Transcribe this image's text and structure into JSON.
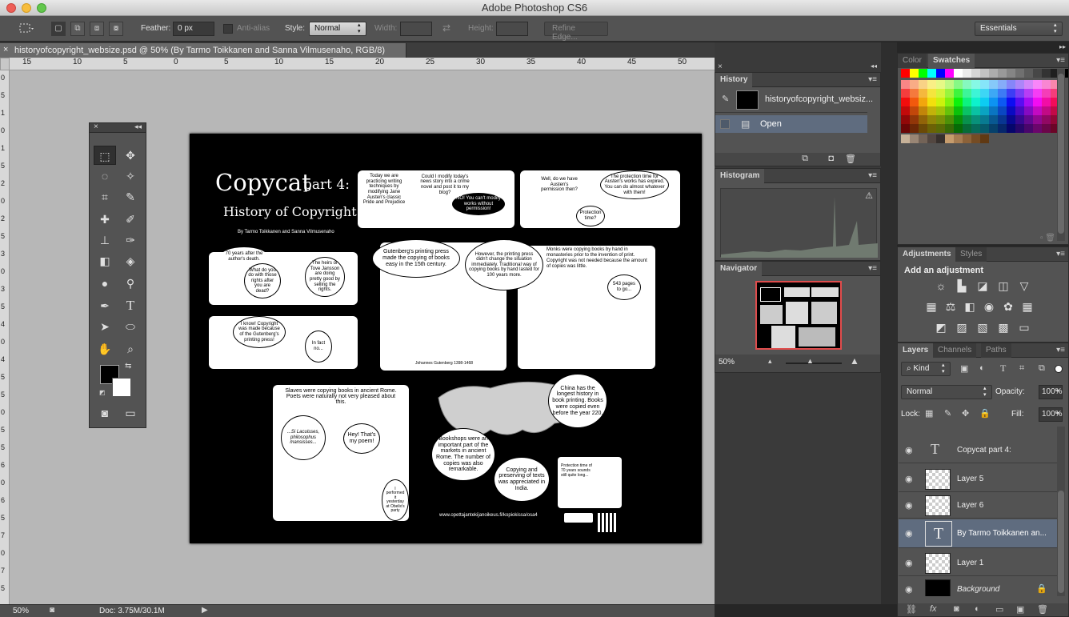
{
  "app": {
    "title": "Adobe Photoshop CS6"
  },
  "options": {
    "feather_label": "Feather:",
    "feather_value": "0 px",
    "antialias_label": "Anti-alias",
    "style_label": "Style:",
    "style_value": "Normal",
    "width_label": "Width:",
    "height_label": "Height:",
    "refine_edge": "Refine Edge...",
    "workspace": "Essentials"
  },
  "document": {
    "tab_title": "historyofcopyright_websize.psd @ 50% (By Tarmo Toikkanen and Sanna Vilmusenaho, RGB/8)",
    "zoom": "50%",
    "doc_size": "Doc: 3.75M/30.1M"
  },
  "ruler": {
    "h_ticks": [
      "15",
      "10",
      "5",
      "0",
      "5",
      "10",
      "15",
      "20",
      "25",
      "30",
      "35",
      "40",
      "45",
      "50"
    ],
    "v_ticks": [
      "0",
      "5",
      "1",
      "0",
      "1",
      "5",
      "2",
      "0",
      "2",
      "5",
      "3",
      "0",
      "3",
      "5",
      "4",
      "0",
      "4",
      "5",
      "5",
      "0",
      "5",
      "5",
      "6",
      "0",
      "6",
      "5",
      "7",
      "0",
      "7",
      "5"
    ]
  },
  "artwork": {
    "title": "Copycat",
    "part": "part 4:",
    "subtitle": "History of Copyright",
    "byline": "By Tarmo Toikkanen and Sanna Vilmusenaho",
    "url": "www.opettajantekijanoikeus.fi/kopiokissa/osa4",
    "bubbles": {
      "b1": "Today we are practicing writing techniques by modifying Jane Austen's classic Pride and Prejudice",
      "b2": "Could I modify today's news story into a crime novel and post it to my blog?",
      "b3": "NO! You can't modify works without permission!",
      "b4": "Well, do we have Austen's permission then?",
      "b5": "The protection time for Austen's works has expired. You can do almost whatever with them!",
      "b6": "Protection time?",
      "b7": "70 years after the author's death.",
      "b8": "What do you do with those rights after you are dead?",
      "b9": "The heirs or Tove Jansson are doing pretty good by selling the rights.",
      "b10": "Gutenberg's printing press made the copying of books easy in the 15th century.",
      "b11": "However, the printing press didn't change the situation immediately. Traditional way of copying books by hand lasted for 100 years more.",
      "b12": "Monks were copying books by hand in monasteries prior to the invention of print. Copyright was not needed because the amount of copies was little.",
      "b13": "543 pages to go...",
      "b14": "I know! Copyright was made because of the Gutenberg's printing press!",
      "b15": "In fact no...",
      "caption_gutenberg": "Johannes Gutenberg 1398-1468",
      "b16": "Slaves were copying books in ancient Rome. Poets were naturally not very pleased about this.",
      "b17": "...Si Lacuisses, philosophus mansisses...",
      "b18": "Hey! That's my poem!",
      "b19": "I performed it yesterday at Obelix's party",
      "b20": "China has the longest history in book printing. Books were copied even before the year 220.",
      "b21": "Bookshops were an important part of the markets in ancient Rome. The number of copies was also remarkable.",
      "b22": "Copying and preserving of texts was appreciated in India.",
      "b23": "Protection time of 70 years sounds still quite long..."
    }
  },
  "panels": {
    "history": {
      "title": "History",
      "snapshot": "historyofcopyright_websiz...",
      "step": "Open"
    },
    "histogram": {
      "title": "Histogram"
    },
    "navigator": {
      "title": "Navigator",
      "zoom": "50%"
    },
    "color_tab": "Color",
    "swatches_tab": "Swatches",
    "adjustments_tab": "Adjustments",
    "styles_tab": "Styles",
    "add_adjustment": "Add an adjustment",
    "layers_tab": "Layers",
    "channels_tab": "Channels",
    "paths_tab": "Paths"
  },
  "layers_panel": {
    "filter": "Kind",
    "blend_mode": "Normal",
    "opacity_label": "Opacity:",
    "opacity_value": "100%",
    "lock_label": "Lock:",
    "fill_label": "Fill:",
    "fill_value": "100%",
    "layers": [
      {
        "name": "Copycat part 4:",
        "type": "text"
      },
      {
        "name": "Layer 5",
        "type": "pixel"
      },
      {
        "name": "Layer 6",
        "type": "pixel"
      },
      {
        "name": "By Tarmo Toikkanen an...",
        "type": "text",
        "selected": true
      },
      {
        "name": "Layer 1",
        "type": "pixel"
      },
      {
        "name": "Background",
        "type": "background"
      }
    ]
  },
  "colors": {
    "foreground": "#000000",
    "background": "#ffffff",
    "selected_layer": "#5f6c7f",
    "history_selected": "#5f6c7f"
  },
  "icons": [
    "marquee-icon",
    "move-icon",
    "lasso-icon",
    "magic-wand-icon",
    "crop-icon",
    "eyedropper-icon",
    "healing-brush-icon",
    "brush-icon",
    "clone-stamp-icon",
    "history-brush-icon",
    "eraser-icon",
    "paint-bucket-icon",
    "blur-icon",
    "dodge-icon",
    "pen-icon",
    "type-icon",
    "path-selection-icon",
    "ellipse-icon",
    "hand-icon",
    "zoom-icon"
  ]
}
